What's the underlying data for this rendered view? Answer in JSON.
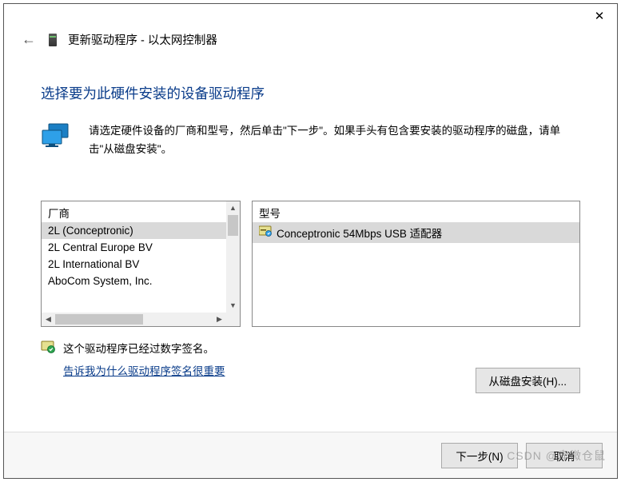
{
  "window": {
    "close_symbol": "✕",
    "back_symbol": "←",
    "title": "更新驱动程序 - 以太网控制器"
  },
  "heading": "选择要为此硬件安装的设备驱动程序",
  "instruction": "请选定硬件设备的厂商和型号，然后单击\"下一步\"。如果手头有包含要安装的驱动程序的磁盘，请单击\"从磁盘安装\"。",
  "manufacturer": {
    "header": "厂商",
    "items": [
      {
        "label": "2L (Conceptronic)",
        "selected": true
      },
      {
        "label": "2L Central Europe BV",
        "selected": false
      },
      {
        "label": "2L International BV",
        "selected": false
      },
      {
        "label": "AboCom System, Inc.",
        "selected": false
      }
    ]
  },
  "model": {
    "header": "型号",
    "items": [
      {
        "label": "Conceptronic 54Mbps USB 适配器",
        "selected": true
      }
    ]
  },
  "signature": {
    "text": "这个驱动程序已经过数字签名。",
    "link": "告诉我为什么驱动程序签名很重要"
  },
  "buttons": {
    "disk_install": "从磁盘安装(H)...",
    "next": "下一步(N)",
    "cancel": "取消"
  },
  "watermark": "CSDN @卑微仓鼠"
}
